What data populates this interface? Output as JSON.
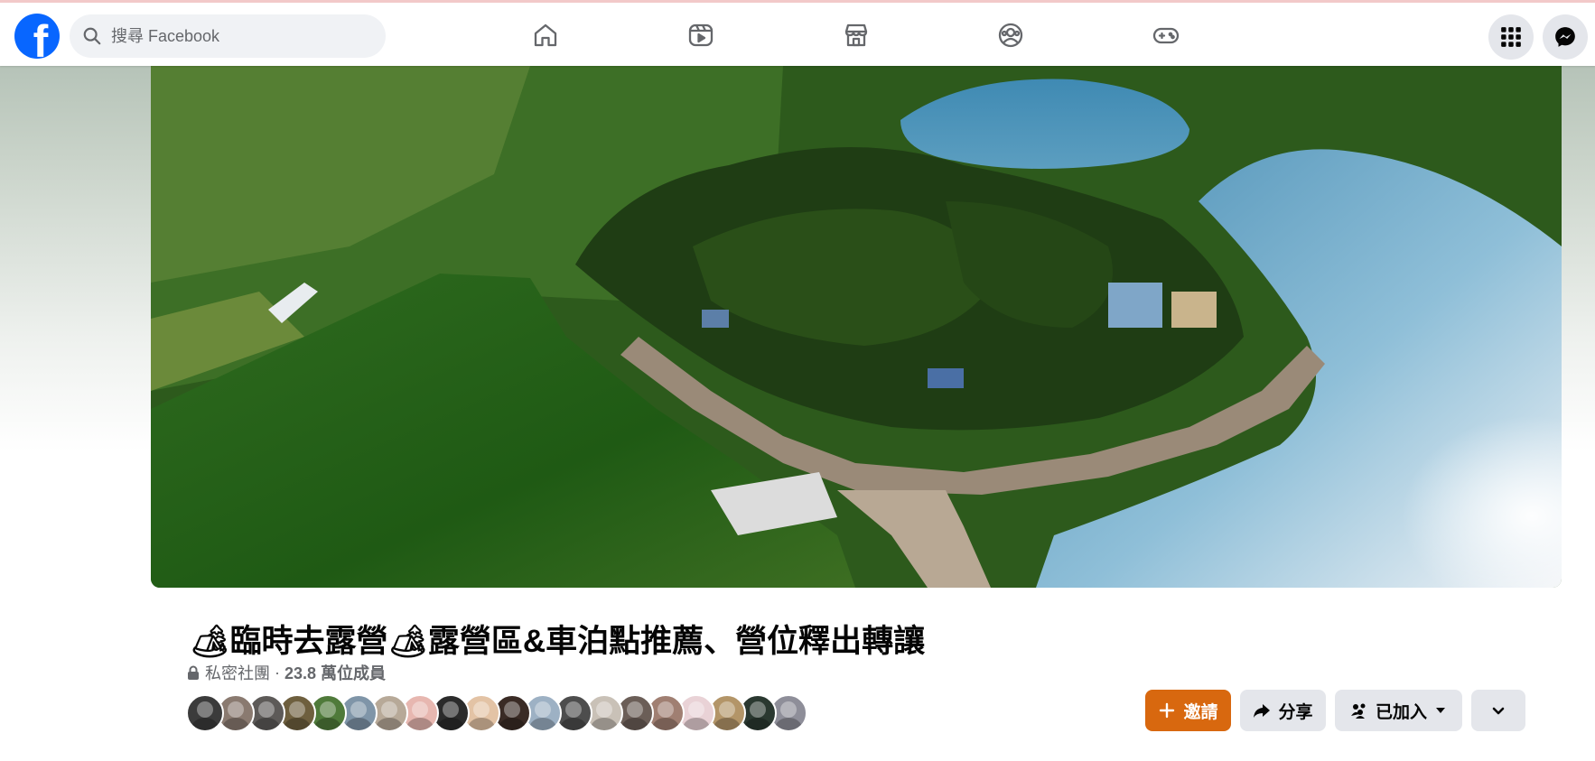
{
  "topbar": {
    "logo_letter": "f",
    "search_placeholder": "搜尋 Facebook",
    "nav_icons": [
      "home-icon",
      "video-icon",
      "marketplace-icon",
      "groups-icon",
      "gaming-icon"
    ],
    "right_icons": [
      "menu-grid-icon",
      "messenger-icon"
    ]
  },
  "group": {
    "title_emoji": "🏕",
    "title_part1": "臨時去露營",
    "title_part2": "露營區&車泊點推薦、營位釋出轉讓",
    "privacy": "私密社團",
    "separator": "·",
    "member_count": "23.8 萬位成員",
    "member_avatar_count": 20
  },
  "actions": {
    "invite_label": "邀請",
    "share_label": "分享",
    "joined_label": "已加入"
  },
  "colors": {
    "facebook_blue": "#0866ff",
    "invite_orange": "#d8680f",
    "secondary_button": "#e4e6eb",
    "icon_gray": "#65676b"
  }
}
